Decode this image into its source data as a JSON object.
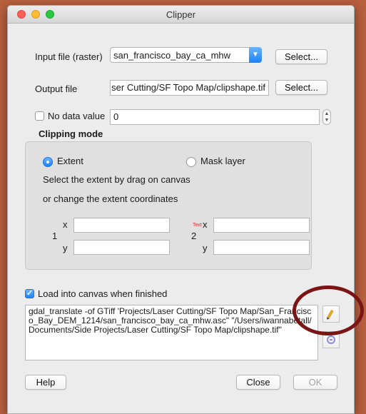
{
  "window": {
    "title": "Clipper"
  },
  "input_file": {
    "label": "Input file (raster)",
    "value": "san_francisco_bay_ca_mhw",
    "select_label": "Select..."
  },
  "output_file": {
    "label": "Output file",
    "value": "ser Cutting/SF Topo Map/clipshape.tif",
    "select_label": "Select..."
  },
  "no_data": {
    "label": "No data value",
    "checked": false,
    "value": "0"
  },
  "clipping_mode": {
    "heading": "Clipping mode",
    "options": [
      {
        "label": "Extent",
        "selected": true
      },
      {
        "label": "Mask layer",
        "selected": false
      }
    ],
    "instruction_1": "Select the extent by drag on canvas",
    "instruction_2": "or change the extent coordinates",
    "point1": {
      "number": "1",
      "x_label": "x",
      "y_label": "y",
      "x_value": "",
      "y_value": ""
    },
    "point2": {
      "number": "2",
      "x_label": "x",
      "y_label": "y",
      "x_value": "",
      "y_value": "",
      "tag": "Text"
    }
  },
  "load_canvas": {
    "label": "Load into canvas when finished",
    "checked": true
  },
  "command": "gdal_translate -of GTiff 'Projects/Laser Cutting/SF Topo Map/San_Francisco_Bay_DEM_1214/san_francisco_bay_ca_mhw.asc\" \"/Users/iwannabetall/Documents/Side Projects/Laser Cutting/SF Topo Map/clipshape.tif\"",
  "footer": {
    "help": "Help",
    "close": "Close",
    "ok": "OK"
  },
  "icons": {
    "edit": "pencil-icon",
    "reset": "circle-icon"
  },
  "colors": {
    "accent": "#1a82fb",
    "annotation": "#7b1414",
    "background": "#b7603f"
  }
}
